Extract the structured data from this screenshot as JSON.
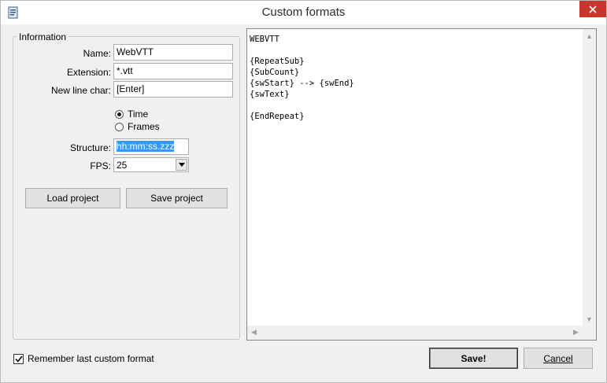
{
  "window": {
    "title": "Custom formats"
  },
  "information": {
    "group_label": "Information",
    "name_label": "Name:",
    "name_value": "WebVTT",
    "extension_label": "Extension:",
    "extension_value": "*.vtt",
    "newline_label": "New line char:",
    "newline_value": "[Enter]",
    "radio_time": "Time",
    "radio_frames": "Frames",
    "radio_selected": "Time",
    "structure_label": "Structure:",
    "structure_value": "hh:mm:ss.zzz",
    "fps_label": "FPS:",
    "fps_value": "25",
    "load_project": "Load project",
    "save_project": "Save project"
  },
  "editor": {
    "content": "WEBVTT\n\n{RepeatSub}\n{SubCount}\n{swStart} --> {swEnd}\n{swText}\n\n{EndRepeat}"
  },
  "footer": {
    "remember_label": "Remember last custom format",
    "remember_checked": true,
    "save_button": "Save!",
    "cancel_button": "Cancel"
  },
  "icons": {
    "app": "app-document-icon",
    "close": "close-icon",
    "dropdown": "chevron-down-icon",
    "check": "checkmark-icon"
  },
  "colors": {
    "close_bg": "#c7362b",
    "selection": "#3399ff"
  }
}
